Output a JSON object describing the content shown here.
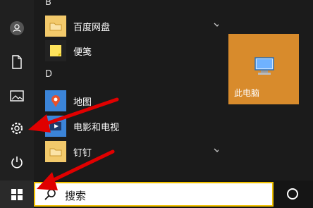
{
  "start_menu": {
    "section_b": "B",
    "section_d": "D",
    "apps": [
      {
        "label": "百度网盘",
        "icon": "folder-icon",
        "color": "#f2c96b",
        "has_chevron": true
      },
      {
        "label": "便笺",
        "icon": "sticky-notes-icon",
        "color": "#222222",
        "has_chevron": false
      },
      {
        "label": "地图",
        "icon": "maps-icon",
        "color": "#3b84d8",
        "has_chevron": false
      },
      {
        "label": "电影和电视",
        "icon": "movies-tv-icon",
        "color": "#3b84d8",
        "has_chevron": false
      },
      {
        "label": "钉钉",
        "icon": "folder-icon",
        "color": "#f2c96b",
        "has_chevron": true
      }
    ],
    "tile": {
      "label": "此电脑",
      "icon": "this-pc-icon",
      "color": "#d88b2c"
    }
  },
  "rail": {
    "items": [
      "user-icon",
      "document-icon",
      "pictures-icon",
      "settings-icon",
      "power-icon"
    ]
  },
  "taskbar": {
    "search_text": "搜索",
    "start_icon": "windows-logo-icon",
    "cortana_icon": "cortana-icon"
  },
  "annotations": {
    "arrow_color": "#e00000",
    "arrows": [
      "settings-pointer-arrow",
      "search-pointer-arrow"
    ]
  }
}
